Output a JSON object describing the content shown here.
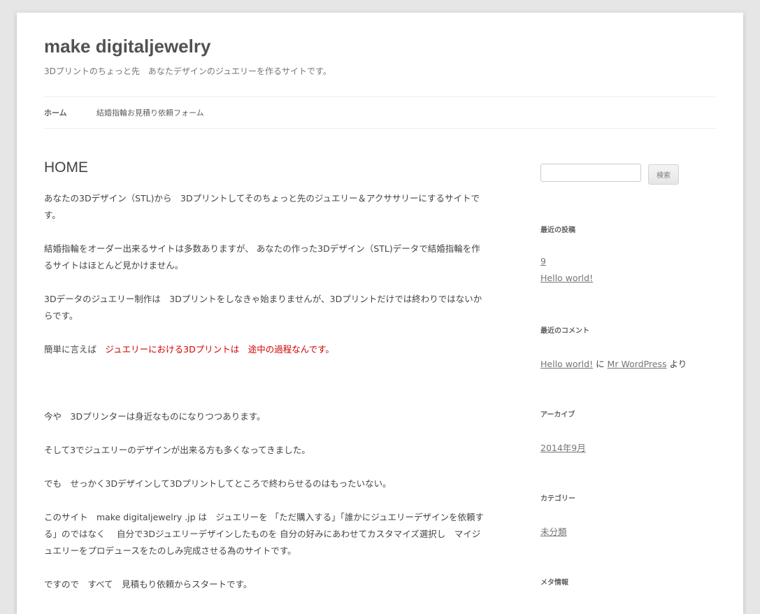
{
  "header": {
    "site_title": "make digitaljewelry",
    "site_description": "3Dプリントのちょっと先　あなたデザインのジュエリーを作るサイトです。"
  },
  "nav": {
    "items": [
      {
        "label": "ホーム",
        "current": true
      },
      {
        "label": "結婚指輪お見積り依頼フォーム",
        "current": false
      }
    ]
  },
  "content": {
    "title": "HOME",
    "paragraphs": {
      "p1": "あなたの3Dデザイン（STL)から　3Dプリントしてそのちょっと先のジュエリー＆アクササリーにするサイトです。",
      "p2": "結婚指輪をオーダー出来るサイトは多数ありますが、 あなたの作った3Dデザイン（STL)データで結婚指輪を作るサイトはほとんど見かけません。",
      "p3": "3Dデータのジュエリー制作は　3Dプリントをしなきゃ始まりませんが、3Dプリントだけでは終わりではないからです。",
      "p4_prefix": "簡単に言えば　",
      "p4_highlight": "ジュエリーにおける3Dプリントは　途中の過程なんです。",
      "p5": "今や　3Dプリンターは身近なものになりつつあります。",
      "p6": "そして3でジュエリーのデザインが出来る方も多くなってきました。",
      "p7": "でも　せっかく3Dデザインして3Dプリントしてところで終わらせるのはもったいない。",
      "p8": "このサイト　make digitaljewelry .jp は　ジュエリーを 「ただ購入する」「誰かにジュエリーデザインを依頼する」のではなく　 自分で3Dジュエリーデザインしたものを 自分の好みにあわせてカスタマイズ選択し　マイジュエリーをプロデュースをたのしみ完成させる為のサイトです。",
      "p9": "ですので　すべて　見積もり依頼からスタートです。"
    },
    "highlight_color": "#d10000"
  },
  "sidebar": {
    "search": {
      "placeholder": "",
      "button_label": "検索"
    },
    "recent_posts": {
      "title": "最近の投稿",
      "items": [
        "9",
        "Hello world!"
      ]
    },
    "recent_comments": {
      "title": "最近のコメント",
      "post_link": "Hello world!",
      "connector": " に ",
      "author_link": "Mr WordPress",
      "suffix": " より"
    },
    "archives": {
      "title": "アーカイブ",
      "items": [
        "2014年9月"
      ]
    },
    "categories": {
      "title": "カテゴリー",
      "items": [
        "未分類"
      ]
    },
    "meta": {
      "title": "メタ情報"
    }
  }
}
